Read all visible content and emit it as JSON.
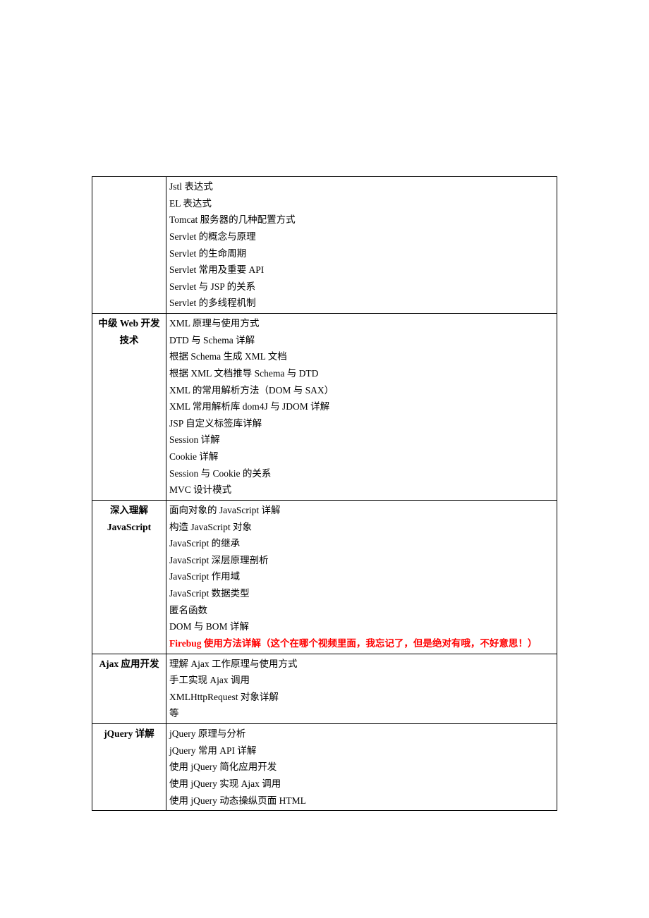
{
  "sections": [
    {
      "category": "",
      "items": [
        {
          "text": "Jstl 表达式"
        },
        {
          "text": "EL 表达式"
        },
        {
          "text": "Tomcat 服务器的几种配置方式"
        },
        {
          "text": "Servlet 的概念与原理"
        },
        {
          "text": "Servlet 的生命周期"
        },
        {
          "text": "Servlet 常用及重要 API"
        },
        {
          "text": "Servlet 与 JSP 的关系"
        },
        {
          "text": "Servlet 的多线程机制"
        }
      ]
    },
    {
      "category": "中级 Web 开发技术",
      "items": [
        {
          "text": "XML 原理与使用方式"
        },
        {
          "text": "DTD 与 Schema 详解"
        },
        {
          "text": "根据 Schema 生成 XML 文档"
        },
        {
          "text": "根据 XML 文档推导 Schema 与 DTD"
        },
        {
          "text": "XML 的常用解析方法（DOM 与 SAX）"
        },
        {
          "text": "XML 常用解析库 dom4J 与 JDOM 详解"
        },
        {
          "text": "JSP 自定义标签库详解"
        },
        {
          "text": "Session 详解"
        },
        {
          "text": "Cookie 详解"
        },
        {
          "text": "Session 与 Cookie 的关系"
        },
        {
          "text": "MVC 设计模式"
        }
      ]
    },
    {
      "category": "深入理解 JavaScript",
      "items": [
        {
          "text": "面向对象的 JavaScript 详解"
        },
        {
          "text": "构造 JavaScript 对象"
        },
        {
          "text": "JavaScript 的继承"
        },
        {
          "text": "JavaScript 深层原理剖析"
        },
        {
          "text": "JavaScript 作用域"
        },
        {
          "text": "JavaScript 数据类型"
        },
        {
          "text": "匿名函数"
        },
        {
          "text": "DOM 与 BOM 详解"
        },
        {
          "text": "Firebug 使用方法详解（这个在哪个视频里面，我忘记了，但是绝对有哦，不好意思！）",
          "highlight": true
        }
      ]
    },
    {
      "category": "Ajax 应用开发",
      "items": [
        {
          "text": "理解 Ajax 工作原理与使用方式"
        },
        {
          "text": "手工实现 Ajax 调用"
        },
        {
          "text": "XMLHttpRequest 对象详解"
        },
        {
          "text": "等"
        }
      ]
    },
    {
      "category": "jQuery 详解",
      "items": [
        {
          "text": "jQuery 原理与分析"
        },
        {
          "text": "jQuery 常用 API 详解"
        },
        {
          "text": "使用 jQuery 简化应用开发"
        },
        {
          "text": "使用 jQuery 实现 Ajax 调用"
        },
        {
          "text": "使用 jQuery 动态操纵页面 HTML"
        }
      ]
    }
  ]
}
